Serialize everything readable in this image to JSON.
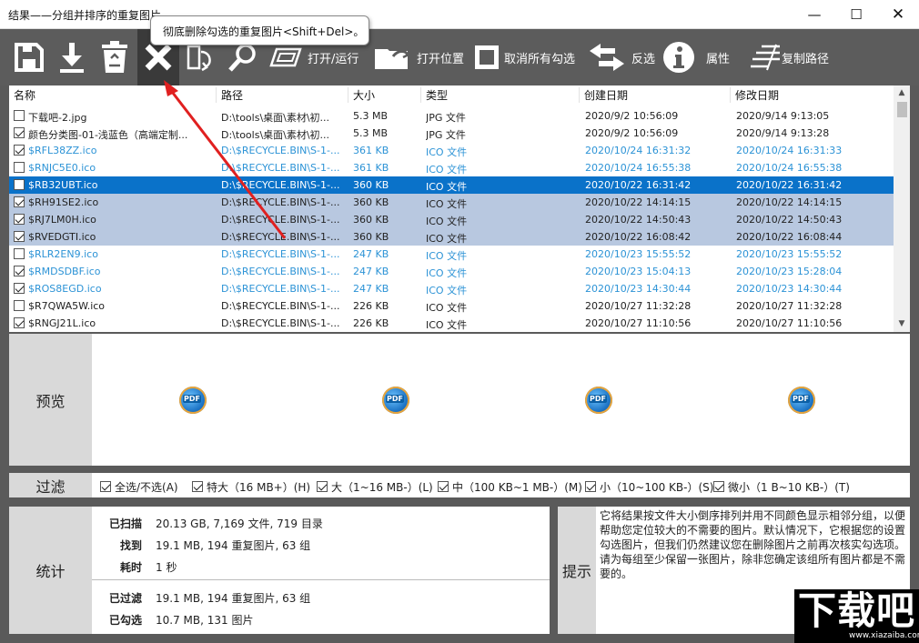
{
  "window": {
    "title": "结果——分组并排序的重复图片",
    "tooltip": "彻底删除勾选的重复图片<Shift+Del>。",
    "controls": {
      "minimize": "—",
      "maximize": "☐",
      "close": "✕"
    }
  },
  "toolbar": {
    "open_run": "打开/运行",
    "open_location": "打开位置",
    "uncheck_all": "取消所有勾选",
    "invert": "反选",
    "properties": "属性",
    "copy_path": "复制路径"
  },
  "list": {
    "columns": [
      "名称",
      "路径",
      "大小",
      "类型",
      "创建日期",
      "修改日期"
    ],
    "rows": [
      {
        "checked": false,
        "name": "下载吧-2.jpg",
        "path": "D:\\tools\\桌面\\素材\\初...",
        "size": "5.3 MB",
        "type": "JPG 文件",
        "created": "2020/9/2 10:56:09",
        "modified": "2020/9/14 9:13:05",
        "style": "normal"
      },
      {
        "checked": true,
        "name": "颜色分类图-01-浅蓝色（高端定制...",
        "path": "D:\\tools\\桌面\\素材\\初...",
        "size": "5.3 MB",
        "type": "JPG 文件",
        "created": "2020/9/2 10:56:09",
        "modified": "2020/9/14 9:13:28",
        "style": "normal"
      },
      {
        "checked": true,
        "name": "$RFL38ZZ.ico",
        "path": "D:\\$RECYCLE.BIN\\S-1-...",
        "size": "361 KB",
        "type": "ICO 文件",
        "created": "2020/10/24 16:31:32",
        "modified": "2020/10/24 16:31:33",
        "style": "blue"
      },
      {
        "checked": false,
        "name": "$RNJC5E0.ico",
        "path": "D:\\$RECYCLE.BIN\\S-1-...",
        "size": "361 KB",
        "type": "ICO 文件",
        "created": "2020/10/24 16:55:38",
        "modified": "2020/10/24 16:55:38",
        "style": "blue"
      },
      {
        "checked": false,
        "name": "$RB32UBT.ico",
        "path": "D:\\$RECYCLE.BIN\\S-1-...",
        "size": "360 KB",
        "type": "ICO 文件",
        "created": "2020/10/22 16:31:42",
        "modified": "2020/10/22 16:31:42",
        "style": "sel"
      },
      {
        "checked": true,
        "name": "$RH91SE2.ico",
        "path": "D:\\$RECYCLE.BIN\\S-1-...",
        "size": "360 KB",
        "type": "ICO 文件",
        "created": "2020/10/22 14:14:15",
        "modified": "2020/10/22 14:14:15",
        "style": "hl"
      },
      {
        "checked": true,
        "name": "$RJ7LM0H.ico",
        "path": "D:\\$RECYCLE.BIN\\S-1-...",
        "size": "360 KB",
        "type": "ICO 文件",
        "created": "2020/10/22 14:50:43",
        "modified": "2020/10/22 14:50:43",
        "style": "hl"
      },
      {
        "checked": true,
        "name": "$RVEDGTI.ico",
        "path": "D:\\$RECYCLE.BIN\\S-1-...",
        "size": "360 KB",
        "type": "ICO 文件",
        "created": "2020/10/22 16:08:42",
        "modified": "2020/10/22 16:08:44",
        "style": "hl"
      },
      {
        "checked": false,
        "name": "$RLR2EN9.ico",
        "path": "D:\\$RECYCLE.BIN\\S-1-...",
        "size": "247 KB",
        "type": "ICO 文件",
        "created": "2020/10/23 15:55:52",
        "modified": "2020/10/23 15:55:52",
        "style": "blue"
      },
      {
        "checked": true,
        "name": "$RMDSDBF.ico",
        "path": "D:\\$RECYCLE.BIN\\S-1-...",
        "size": "247 KB",
        "type": "ICO 文件",
        "created": "2020/10/23 15:04:13",
        "modified": "2020/10/23 15:28:04",
        "style": "blue"
      },
      {
        "checked": true,
        "name": "$ROS8EGD.ico",
        "path": "D:\\$RECYCLE.BIN\\S-1-...",
        "size": "247 KB",
        "type": "ICO 文件",
        "created": "2020/10/23 14:30:44",
        "modified": "2020/10/23 14:30:44",
        "style": "blue"
      },
      {
        "checked": false,
        "name": "$R7QWA5W.ico",
        "path": "D:\\$RECYCLE.BIN\\S-1-...",
        "size": "226 KB",
        "type": "ICO 文件",
        "created": "2020/10/27 11:32:28",
        "modified": "2020/10/27 11:32:28",
        "style": "normal"
      },
      {
        "checked": true,
        "name": "$RNGJ21L.ico",
        "path": "D:\\$RECYCLE.BIN\\S-1-...",
        "size": "226 KB",
        "type": "ICO 文件",
        "created": "2020/10/27 11:10:56",
        "modified": "2020/10/27 11:10:56",
        "style": "normal"
      }
    ]
  },
  "preview": {
    "label": "预览",
    "thumb_text": "PDF"
  },
  "filter": {
    "label": "过滤",
    "items": [
      {
        "checked": true,
        "text": "全选/不选(A)"
      },
      {
        "checked": true,
        "text": "特大（16 MB+）(H)"
      },
      {
        "checked": true,
        "text": "大（1~16 MB-）(L)"
      },
      {
        "checked": true,
        "text": "中（100 KB~1 MB-）(M)"
      },
      {
        "checked": true,
        "text": "小（10~100 KB-）(S)"
      },
      {
        "checked": true,
        "text": "微小（1 B~10 KB-）(T)"
      }
    ]
  },
  "stats": {
    "label": "统计",
    "scanned_k": "已扫描",
    "scanned_v": "20.13 GB, 7,169 文件, 719 目录",
    "found_k": "找到",
    "found_v": "19.1 MB, 194 重复图片, 63 组",
    "time_k": "耗时",
    "time_v": "1 秒",
    "filtered_k": "已过滤",
    "filtered_v": "19.1 MB, 194 重复图片, 63 组",
    "checked_k": "已勾选",
    "checked_v": "10.7 MB, 131 图片"
  },
  "hint": {
    "label": "提示",
    "text": "它将结果按文件大小倒序排列并用不同颜色显示相邻分组，以便帮助您定位较大的不需要的图片。默认情况下，它根据您的设置勾选图片，但我们仍然建议您在删除图片之前再次核实勾选项。请为每组至少保留一张图片，除非您确定该组所有图片都是不需要的。"
  },
  "watermark": {
    "big": "下载吧",
    "small": "www.xiazaiba.com"
  },
  "colors": {
    "selected": "#0a72c9",
    "highlight": "#b8c8e0",
    "blue_text": "#2c93d6",
    "arrow": "#e02020",
    "toolbar": "#5c5c5c"
  }
}
